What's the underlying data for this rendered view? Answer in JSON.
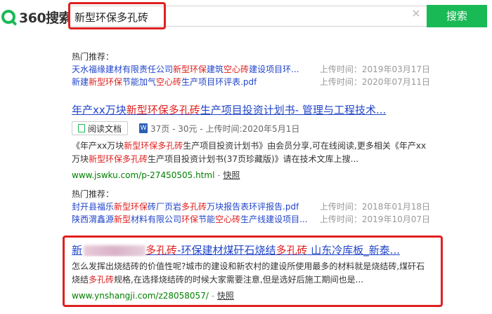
{
  "header": {
    "logo_text": "360搜索",
    "search_value": "新型环保多孔砖",
    "search_button": "搜索",
    "clear_icon": "close-icon",
    "brand_color": "#19b955"
  },
  "hot1": {
    "title": "热门推荐：",
    "items": [
      {
        "parts": [
          "天水福缘建材有限责任公司",
          "新型环保",
          "建筑",
          "空心砖",
          "建设项目环..."
        ],
        "time": "上传时间：2019年03月17日"
      },
      {
        "parts": [
          "新建",
          "新型环保",
          "节能加气",
          "空心砖",
          "生产项目环评表.pdf"
        ],
        "time": "上传时间：2020年07月11日"
      }
    ]
  },
  "result1": {
    "title_pre": "年产xx万块",
    "title_red": "新型环保多孔砖",
    "title_post": "生产项目投资计划书- 管理与工程技术...",
    "read_label": "阅读文档",
    "word_icon": "W",
    "meta": "37页 - 30元 - 上传时间:2020年5月1日",
    "desc_1": "《年产xx万块",
    "desc_2": "新型环保多孔砖",
    "desc_3": "生产项目投资计划书》由会员分享,可在线阅读,更多相关《年产xx万块",
    "desc_4": "新型环保多孔砖",
    "desc_5": "生产项目投资计划书(37页珍藏版)》请在技术文库上搜...",
    "url": "www.jswku.com/p-27450505.html",
    "sep": "-",
    "snapshot": "快照"
  },
  "hot2": {
    "title": "热门推荐：",
    "items": [
      {
        "parts": [
          "封开县福乐",
          "新型环保",
          "砖厂页岩",
          "多孔砖",
          "万块报告表环评报告.pdf"
        ],
        "time": "上传时间：2018年01月18日"
      },
      {
        "parts": [
          "陕西渭鑫源",
          "新型",
          "材料有限公司",
          "环保",
          "节能",
          "空心砖",
          "生产线建设项目..."
        ],
        "time": "上传时间：2019年10月07日"
      }
    ]
  },
  "result2": {
    "title_first": "新",
    "title_red": "多孔砖",
    "title_post": "-环保建材煤矸石烧结",
    "title_red2": "多孔砖",
    "title_tail": " 山东冷库板_新泰...",
    "desc_1": "怎么发挥出烧结砖的价值性呢?城市的建设和新农村的建设所使用最多的材料就是烧结砖,煤矸石烧结",
    "desc_2": "多孔砖",
    "desc_3": "规格,在选择烧结砖的时候大家需要注意,但是选好后施工期间也是...",
    "url": "www.ynshangji.com/z28058057/",
    "sep": "-",
    "snapshot": "快照"
  }
}
